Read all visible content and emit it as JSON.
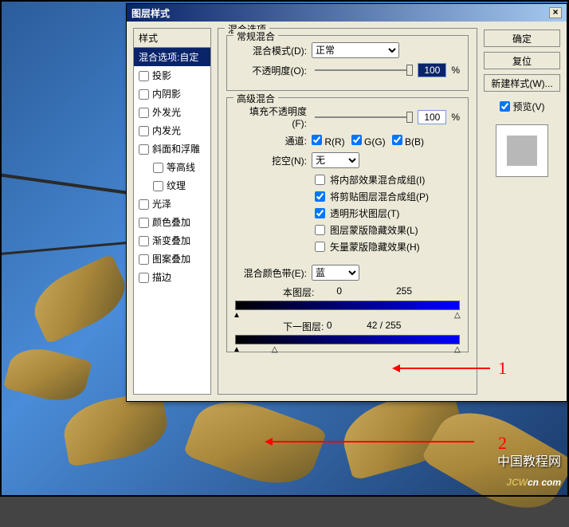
{
  "dialog": {
    "title": "图层样式",
    "close": "×"
  },
  "styles": {
    "header": "样式",
    "blending_options": "混合选项:自定",
    "drop_shadow": "投影",
    "inner_shadow": "内阴影",
    "outer_glow": "外发光",
    "inner_glow": "内发光",
    "bevel_emboss": "斜面和浮雕",
    "contour": "等高线",
    "texture": "纹理",
    "satin": "光泽",
    "color_overlay": "颜色叠加",
    "gradient_overlay": "渐变叠加",
    "pattern_overlay": "图案叠加",
    "stroke": "描边"
  },
  "options": {
    "title": "混合选项",
    "general": {
      "title": "常规混合",
      "blend_mode_label": "混合模式(D):",
      "blend_mode_value": "正常",
      "opacity_label": "不透明度(O):",
      "opacity_value": "100",
      "opacity_unit": "%"
    },
    "advanced": {
      "title": "高级混合",
      "fill_label": "填充不透明度(F):",
      "fill_value": "100",
      "fill_unit": "%",
      "channels_label": "通道:",
      "ch_r": "R(R)",
      "ch_g": "G(G)",
      "ch_b": "B(B)",
      "knockout_label": "挖空(N):",
      "knockout_value": "无",
      "blend_interior": "将内部效果混合成组(I)",
      "blend_clipped": "将剪贴图层混合成组(P)",
      "transparency": "透明形状图层(T)",
      "layer_mask": "图层蒙版隐藏效果(L)",
      "vector_mask": "矢量蒙版隐藏效果(H)"
    },
    "blend_if": {
      "label": "混合颜色带(E):",
      "value": "蓝",
      "this_layer": "本图层:",
      "this_min": "0",
      "this_max": "255",
      "underlying": "下一图层:",
      "under_min": "0",
      "under_mid": "42",
      "under_sep": "/",
      "under_max": "255"
    }
  },
  "buttons": {
    "ok": "确定",
    "cancel": "复位",
    "new_style": "新建样式(W)...",
    "preview": "预览(V)"
  },
  "annotations": {
    "num1": "1",
    "num2": "2"
  },
  "watermark": {
    "cn": "中国教程网",
    "en_j": "JCW",
    "en_cn": "cn",
    "en_com": "com"
  }
}
